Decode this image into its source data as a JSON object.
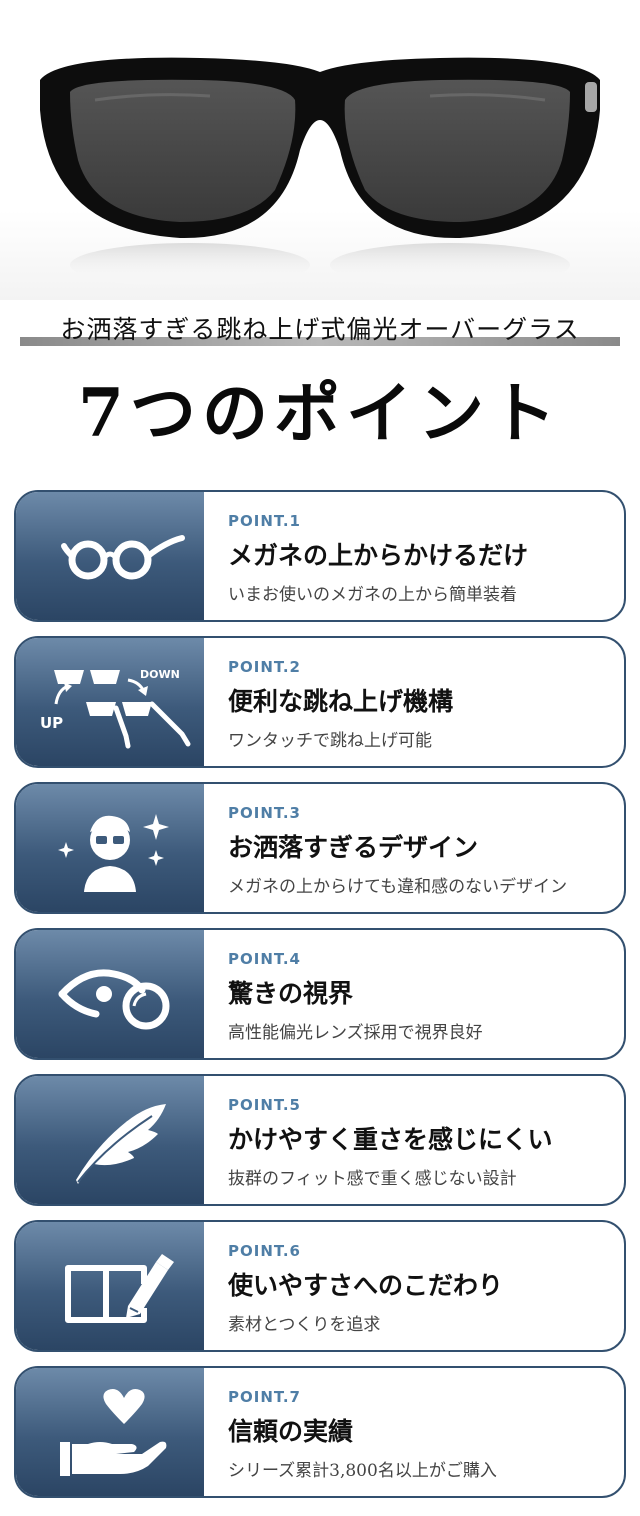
{
  "header": {
    "subtitle": "お洒落すぎる跳ね上げ式偏光オーバーグラス",
    "title": "7つのポイント"
  },
  "points": [
    {
      "label": "POINT.1",
      "title": "メガネの上からかけるだけ",
      "desc": "いまお使いのメガネの上から簡単装着",
      "icon": "glasses-icon"
    },
    {
      "label": "POINT.2",
      "title": "便利な跳ね上げ機構",
      "desc": "ワンタッチで跳ね上げ可能",
      "icon": "flip-up-icon",
      "icon_texts": [
        "UP",
        "DOWN"
      ]
    },
    {
      "label": "POINT.3",
      "title": "お洒落すぎるデザイン",
      "desc": "メガネの上からけても違和感のないデザイン",
      "icon": "stylish-person-icon"
    },
    {
      "label": "POINT.4",
      "title": "驚きの視界",
      "desc": "高性能偏光レンズ採用で視界良好",
      "icon": "eye-lens-icon"
    },
    {
      "label": "POINT.5",
      "title": "かけやすく重さを感じにくい",
      "desc": "抜群のフィット感で重く感じない設計",
      "icon": "feather-icon"
    },
    {
      "label": "POINT.6",
      "title": "使いやすさへのこだわり",
      "desc": "素材とつくりを追求",
      "icon": "book-pen-icon"
    },
    {
      "label": "POINT.7",
      "title": "信頼の実績",
      "desc": "シリーズ累計3,800名以上がご購入",
      "icon": "heart-hand-icon"
    }
  ],
  "colors": {
    "card_border": "#33506f",
    "icon_panel_top": "#6d8aa9",
    "icon_panel_bottom": "#2b4564",
    "point_label": "#4f7ea6"
  }
}
